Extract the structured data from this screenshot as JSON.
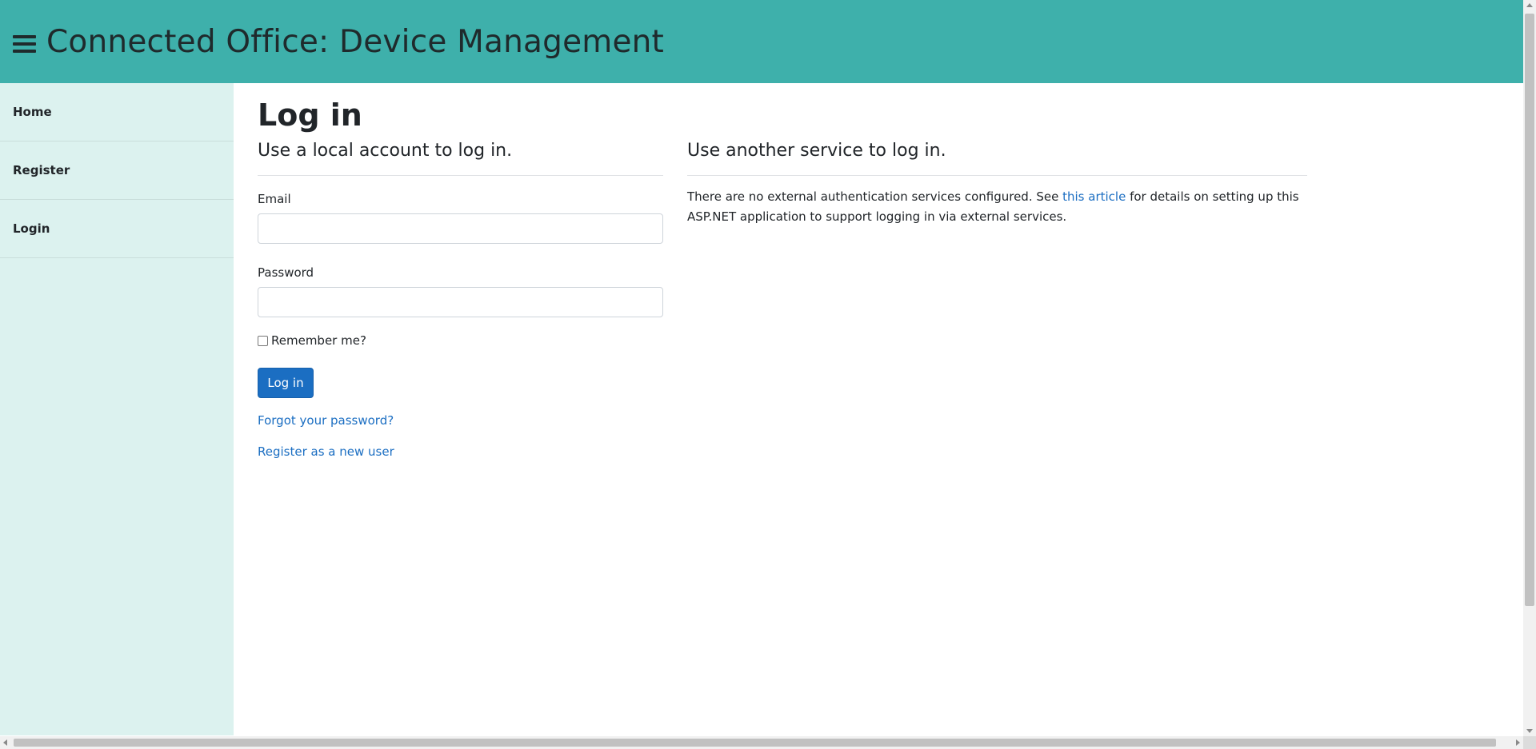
{
  "header": {
    "title": "Connected Office: Device Management",
    "menu_icon": "hamburger-menu-icon",
    "background_color": "#3eb0ab"
  },
  "sidebar": {
    "background_color": "#dcf2ef",
    "items": [
      {
        "label": "Home"
      },
      {
        "label": "Register"
      },
      {
        "label": "Login"
      }
    ]
  },
  "main": {
    "page_title": "Log in",
    "local": {
      "heading": "Use a local account to log in.",
      "email_label": "Email",
      "email_value": "",
      "password_label": "Password",
      "password_value": "",
      "remember_label": "Remember me?",
      "remember_checked": false,
      "submit_label": "Log in",
      "forgot_link": "Forgot your password?",
      "register_link": "Register as a new user"
    },
    "external": {
      "heading": "Use another service to log in.",
      "text_before": "There are no external authentication services configured. See ",
      "link_text": "this article",
      "text_after": " for details on setting up this ASP.NET application to support logging in via external services."
    }
  },
  "colors": {
    "primary_button": "#1b6ec2",
    "link": "#1b6ec2"
  }
}
